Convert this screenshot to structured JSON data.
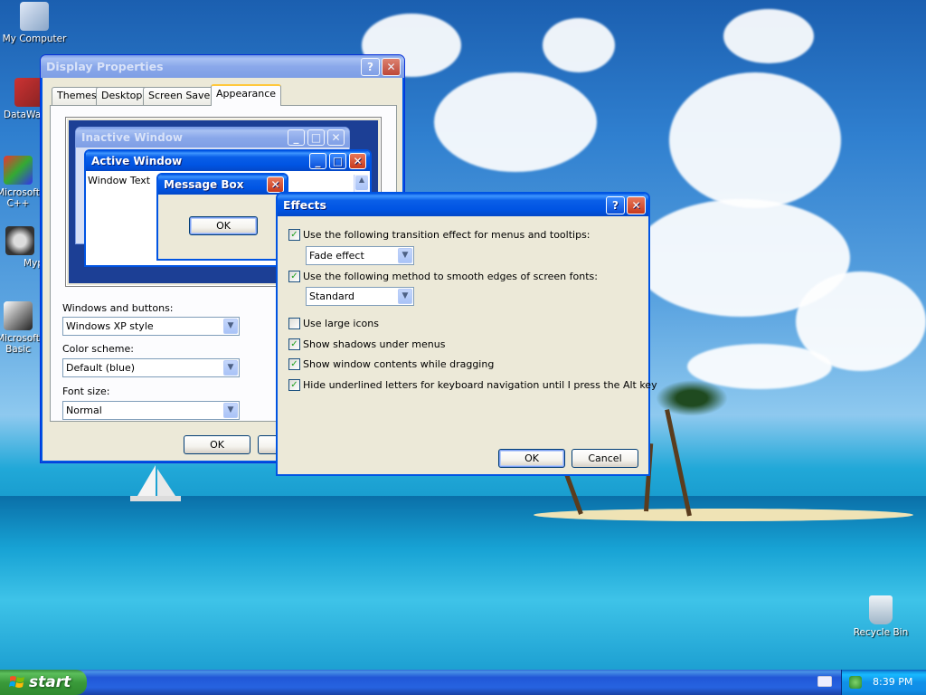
{
  "desktop": {
    "icons": [
      {
        "label": "My Computer"
      },
      {
        "label": "DataWa"
      },
      {
        "label": "Microsoft C++"
      },
      {
        "label": "Myp"
      },
      {
        "label": "Microsoft Basic"
      },
      {
        "label": "Recycle Bin"
      }
    ]
  },
  "display_properties": {
    "title": "Display Properties",
    "help": "?",
    "close": "✕",
    "tabs": [
      "Themes",
      "Desktop",
      "Screen Saver",
      "Appearance"
    ],
    "active_tab": "Appearance",
    "preview": {
      "inactive_title": "Inactive Window",
      "active_title": "Active Window",
      "window_text": "Window Text",
      "msgbox_title": "Message Box",
      "msgbox_ok": "OK"
    },
    "windows_buttons_label": "Windows and buttons:",
    "windows_buttons_value": "Windows XP style",
    "color_scheme_label": "Color scheme:",
    "color_scheme_value": "Default (blue)",
    "font_size_label": "Font size:",
    "font_size_value": "Normal",
    "ok": "OK"
  },
  "effects": {
    "title": "Effects",
    "help": "?",
    "close": "✕",
    "options": [
      {
        "label": "Use the following transition effect for menus and tooltips:",
        "checked": true
      },
      {
        "label": "Use the following method to smooth edges of screen fonts:",
        "checked": true
      },
      {
        "label": "Use large icons",
        "checked": false
      },
      {
        "label": "Show shadows under menus",
        "checked": true
      },
      {
        "label": "Show window contents while dragging",
        "checked": true
      },
      {
        "label": "Hide underlined letters for keyboard navigation until I press the Alt key",
        "checked": true
      }
    ],
    "transition_value": "Fade effect",
    "smoothing_value": "Standard",
    "ok": "OK",
    "cancel": "Cancel"
  },
  "taskbar": {
    "start": "start",
    "clock": "8:39 PM"
  },
  "colors": {
    "xp_blue": "#0054e3",
    "start_green": "#3a9a3a",
    "dialog_face": "#ece9d8"
  }
}
